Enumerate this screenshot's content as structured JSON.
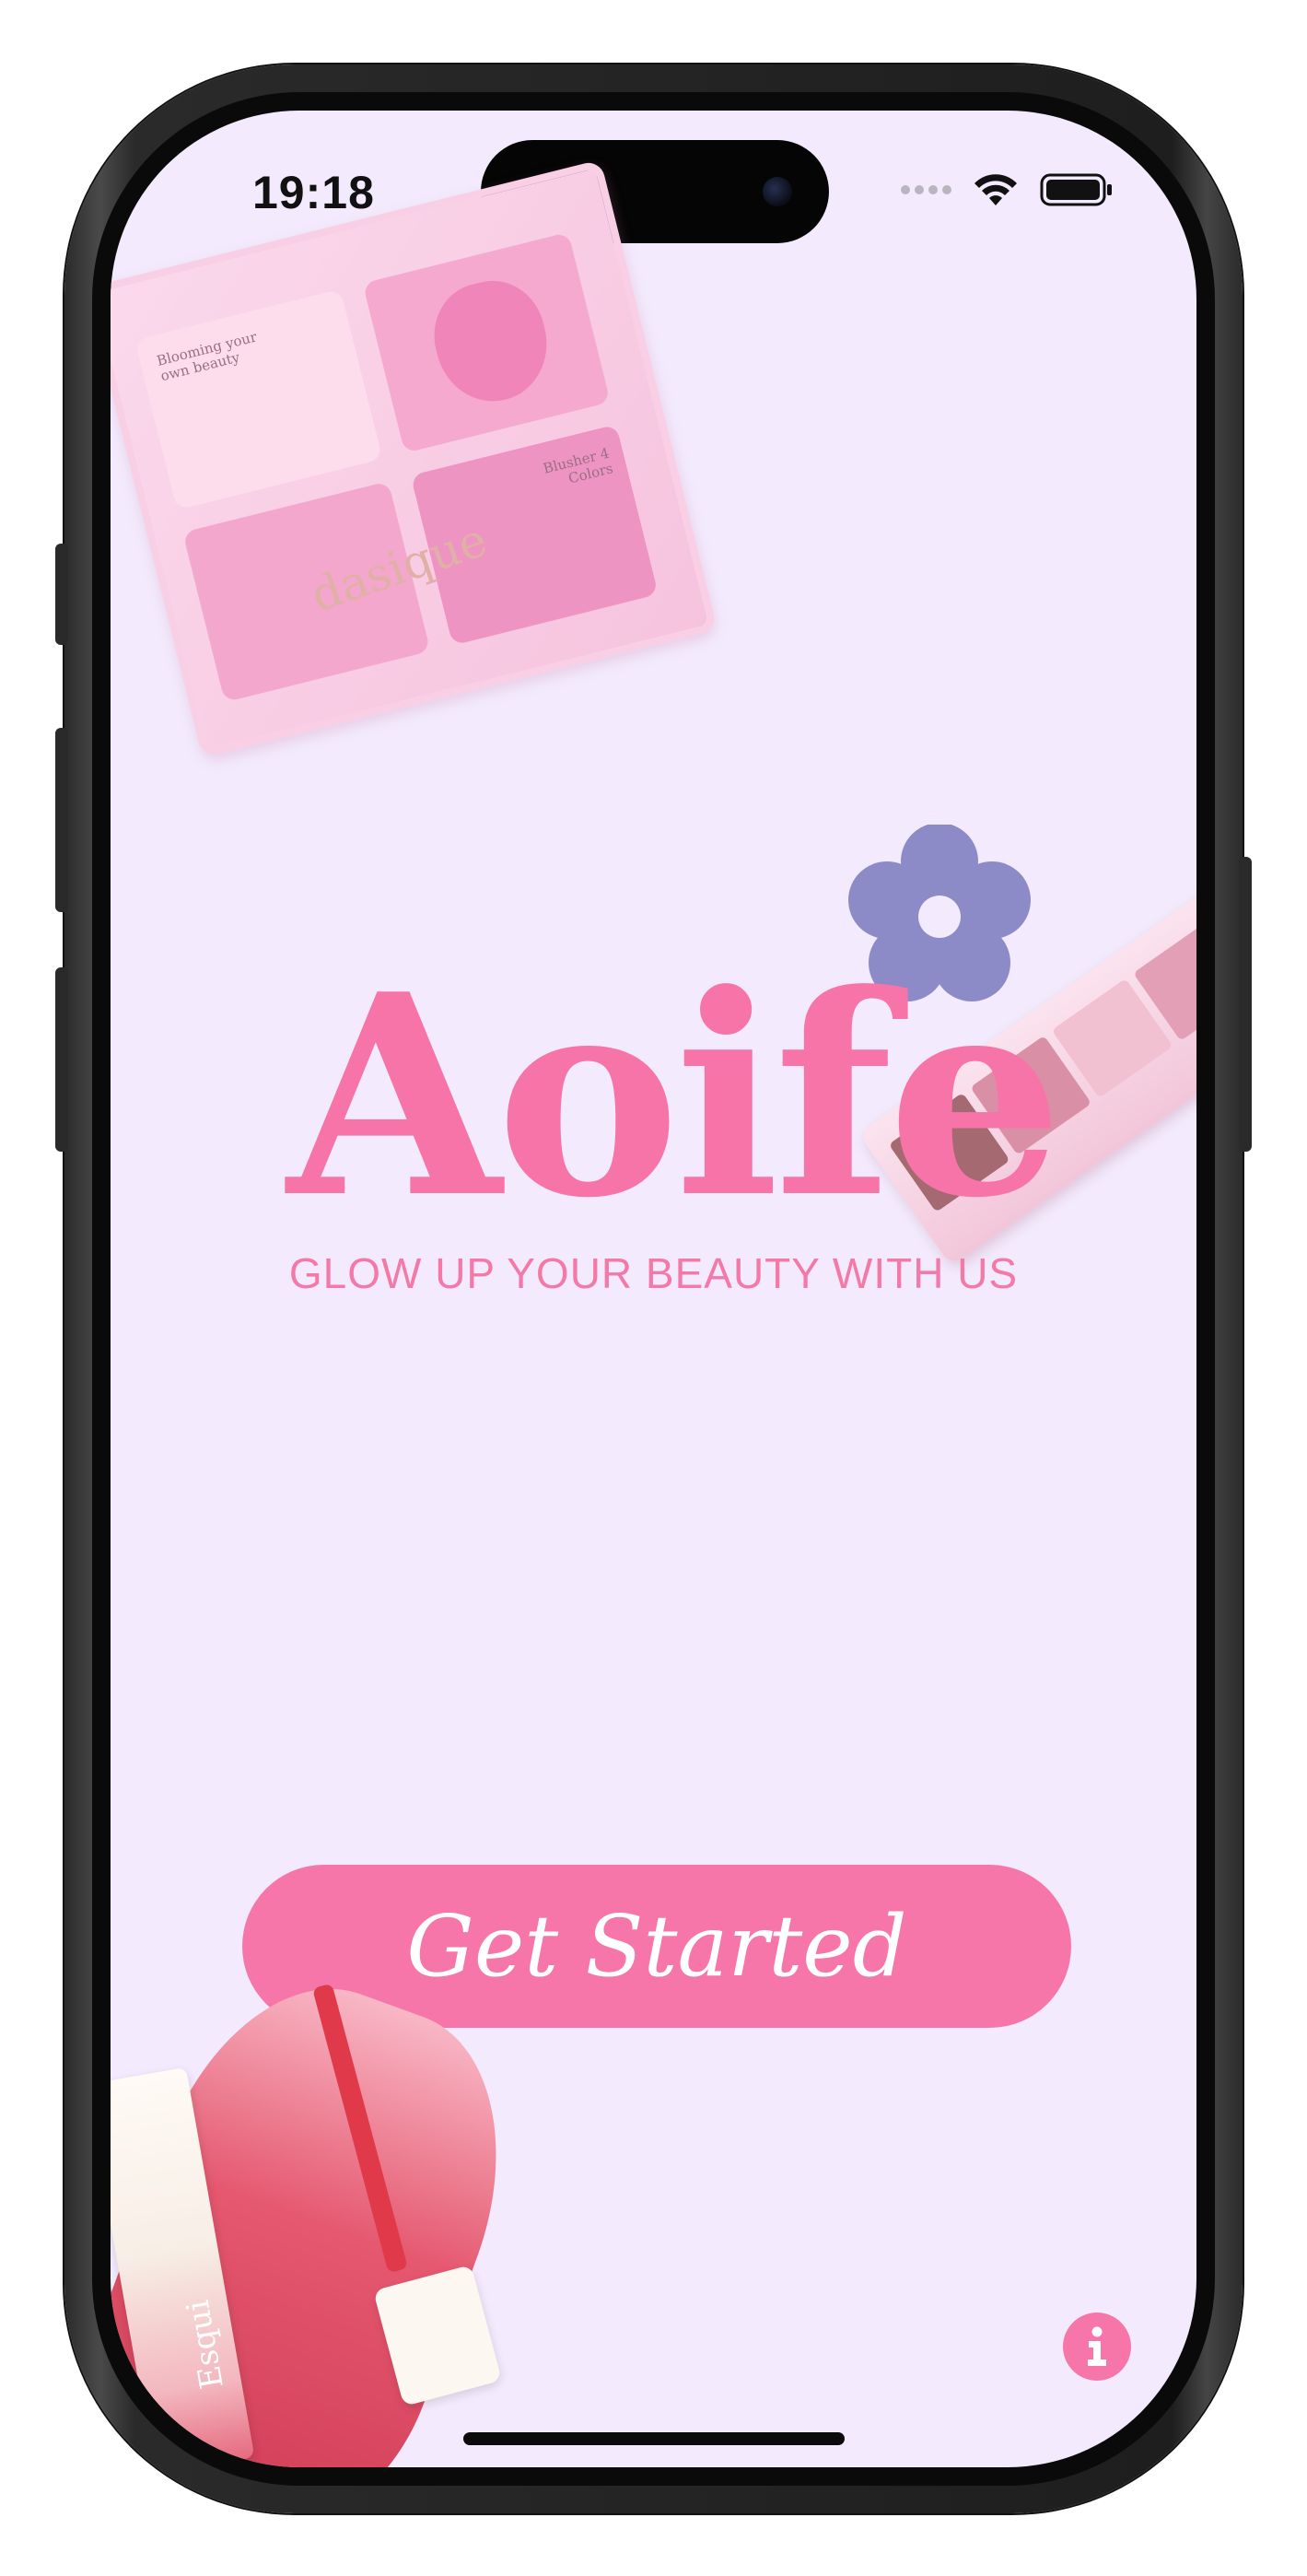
{
  "status_bar": {
    "time": "19:18"
  },
  "products": {
    "blush_brand": "dasique",
    "blush_print_left": "Blooming your own beauty",
    "blush_print_right": "Blusher 4 Colors",
    "lip_brand": "Esqui"
  },
  "logo": {
    "text": "Aoife",
    "tagline": "GLOW UP YOUR BEAUTY WITH US"
  },
  "cta": {
    "label": "Get Started"
  },
  "icons": {
    "info": "info-icon",
    "flower": "flower-icon",
    "wifi": "wifi-icon",
    "battery": "battery-icon"
  },
  "colors": {
    "background": "#f3ebfd",
    "accent_pink": "#f676a9",
    "flower": "#8d8ac8"
  }
}
